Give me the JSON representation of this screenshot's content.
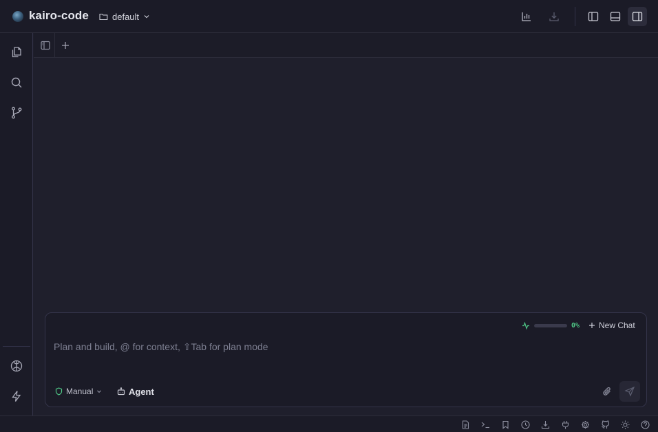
{
  "app": {
    "name": "kairo-code"
  },
  "workspace": {
    "name": "default"
  },
  "titlebar": {
    "buttons": [
      "bar-chart-icon",
      "download-icon",
      "layout-left-panel-icon",
      "layout-bottom-panel-icon",
      "layout-right-panel-icon"
    ],
    "active_button": "layout-right-panel-icon"
  },
  "activitybar": {
    "top_items": [
      "files-icon",
      "search-icon",
      "source-control-icon"
    ],
    "bottom_items": [
      "brain-icon",
      "lightning-icon"
    ]
  },
  "chat": {
    "context_percent": "0%",
    "context_fill": 0,
    "new_chat_label": "New Chat",
    "input_placeholder": "Plan and build, @ for context, ⇧Tab for plan mode",
    "input_value": "",
    "mode_label": "Manual",
    "agent_label": "Agent"
  },
  "statusbar": {
    "icons": [
      "document-icon",
      "terminal-icon",
      "bookmark-icon",
      "history-icon",
      "download-icon",
      "plug-icon",
      "settings-icon",
      "github-icon",
      "sun-icon",
      "help-icon"
    ]
  },
  "colors": {
    "accent_green": "#4fc786",
    "background": "#1f1f2c",
    "panel": "#1b1b27",
    "border": "#34344a"
  }
}
